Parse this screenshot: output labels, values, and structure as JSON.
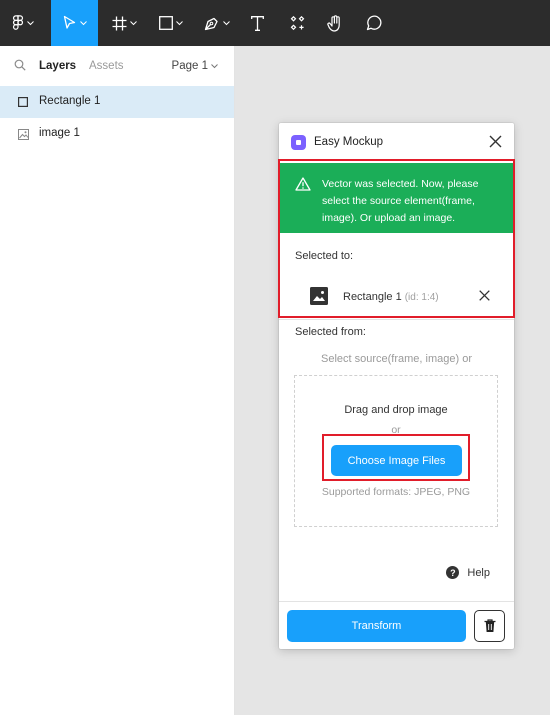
{
  "toolbar": {
    "tools": [
      {
        "name": "main-menu",
        "icon": "figma-logo-icon",
        "has_caret": true
      },
      {
        "name": "move",
        "icon": "move-cursor-icon",
        "has_caret": true,
        "active": true
      },
      {
        "name": "frame",
        "icon": "frame-hash-icon",
        "has_caret": true
      },
      {
        "name": "shape",
        "icon": "rectangle-icon",
        "has_caret": true
      },
      {
        "name": "pen",
        "icon": "pen-icon",
        "has_caret": true
      },
      {
        "name": "text",
        "icon": "text-icon",
        "has_caret": false
      },
      {
        "name": "resources",
        "icon": "components-icon",
        "has_caret": false
      },
      {
        "name": "hand",
        "icon": "hand-icon",
        "has_caret": false
      },
      {
        "name": "comment",
        "icon": "comment-icon",
        "has_caret": false
      }
    ],
    "active_color": "#18a0fb",
    "background": "#2c2c2c"
  },
  "left_panel": {
    "tabs": {
      "layers": "Layers",
      "assets": "Assets"
    },
    "active_tab": "Layers",
    "page_selector": "Page 1",
    "layers": [
      {
        "label": "Rectangle 1",
        "icon": "rectangle-icon",
        "selected": true
      },
      {
        "label": "image 1",
        "icon": "image-icon",
        "selected": false
      }
    ]
  },
  "plugin": {
    "title": "Easy Mockup",
    "alert": {
      "text": "Vector was selected. Now, please select the source element(frame, image). Or upload an image.",
      "color": "#1bae58"
    },
    "selected_to": {
      "label": "Selected to:",
      "item_name": "Rectangle 1",
      "item_id": "(id: 1:4)"
    },
    "selected_from": {
      "label": "Selected from:",
      "hint": "Select source(frame, image) or"
    },
    "dropzone": {
      "text": "Drag and drop image",
      "or": "or",
      "button": "Choose Image Files",
      "formats": "Supported formats: JPEG, PNG"
    },
    "help": "Help",
    "transform_button": "Transform",
    "accent": "#18a0fb"
  },
  "annotations": {
    "color": "#e11d2a"
  }
}
